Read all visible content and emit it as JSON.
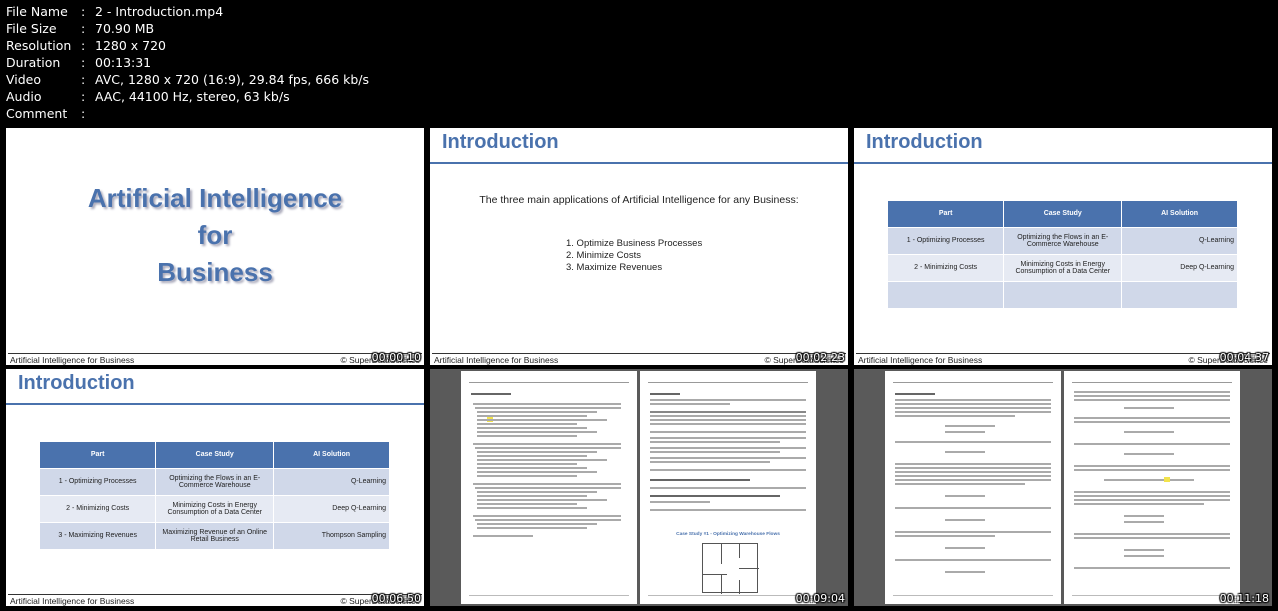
{
  "file_info": [
    {
      "key": "File Name",
      "value": "2 - Introduction.mp4"
    },
    {
      "key": "File Size",
      "value": "70.90 MB"
    },
    {
      "key": "Resolution",
      "value": "1280 x 720"
    },
    {
      "key": "Duration",
      "value": "00:13:31"
    },
    {
      "key": "Video",
      "value": "AVC, 1280 x 720 (16:9), 29.84 fps, 666 kb/s"
    },
    {
      "key": "Audio",
      "value": "AAC, 44100 Hz, stereo, 63 kb/s"
    },
    {
      "key": "Comment",
      "value": ""
    }
  ],
  "separator": ":",
  "footer_left": "Artificial Intelligence for Business",
  "footer_right": "© SuperDataScience",
  "thumbs": [
    {
      "timestamp": "00:00:10",
      "title_lines": [
        "Artificial Intelligence",
        "for",
        "Business"
      ]
    },
    {
      "timestamp": "00:02:23",
      "heading": "Introduction",
      "text": "The three main applications of Artificial Intelligence for any Business:",
      "list": [
        "1. Optimize Business Processes",
        "2. Minimize Costs",
        "3. Maximize Revenues"
      ]
    },
    {
      "timestamp": "00:04:37",
      "heading": "Introduction"
    },
    {
      "timestamp": "00:06:50",
      "heading": "Introduction"
    },
    {
      "timestamp": "00:09:04",
      "case_title": "Case Study #1 - Optimizing Warehouse Flows"
    },
    {
      "timestamp": "00:11:18"
    }
  ],
  "table": {
    "headers": [
      "Part",
      "Case Study",
      "AI Solution"
    ],
    "rows": [
      [
        "1 - Optimizing Processes",
        "Optimizing the Flows in an E-Commerce Warehouse",
        "Q-Learning"
      ],
      [
        "2 - Minimizing Costs",
        "Minimizing Costs in Energy Consumption of a Data Center",
        "Deep Q-Learning"
      ],
      [
        "3 - Maximizing Revenues",
        "Maximizing Revenue of an Online Retail Business",
        "Thompson Sampling"
      ]
    ]
  }
}
